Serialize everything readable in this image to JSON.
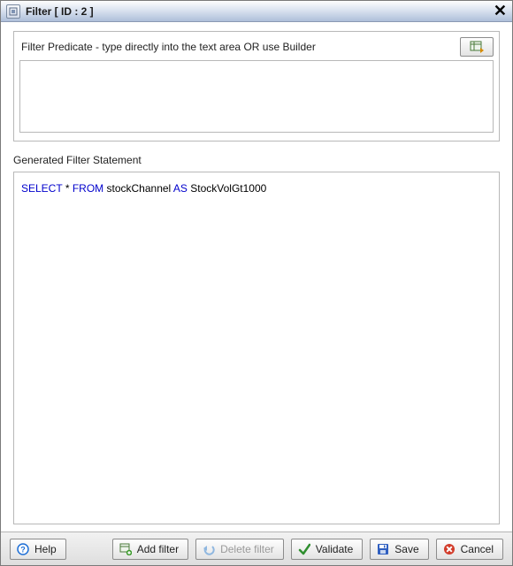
{
  "window": {
    "title": "Filter [ ID : 2 ]"
  },
  "predicate": {
    "label": "Filter Predicate - type directly into the text area OR use Builder",
    "value": "",
    "placeholder": ""
  },
  "generated": {
    "label": "Generated Filter Statement",
    "sql": {
      "kw_select": "SELECT",
      "star": "*",
      "kw_from": "FROM",
      "table": "stockChannel",
      "kw_as": "AS",
      "alias": "StockVolGt1000"
    }
  },
  "buttons": {
    "help": "Help",
    "add_filter": "Add filter",
    "delete_filter": "Delete filter",
    "validate": "Validate",
    "save": "Save",
    "cancel": "Cancel"
  },
  "icons": {
    "window": "filter-window-icon",
    "builder": "builder-icon",
    "help": "help-icon",
    "add": "add-filter-icon",
    "delete": "undo-icon",
    "validate": "check-icon",
    "save": "save-icon",
    "cancel": "cancel-icon",
    "close": "close-icon"
  },
  "colors": {
    "keyword": "#0000cc",
    "titlebar_grad_top": "#fdfdfe",
    "titlebar_grad_bottom": "#aebfda",
    "button_border": "#8c8c8c"
  }
}
